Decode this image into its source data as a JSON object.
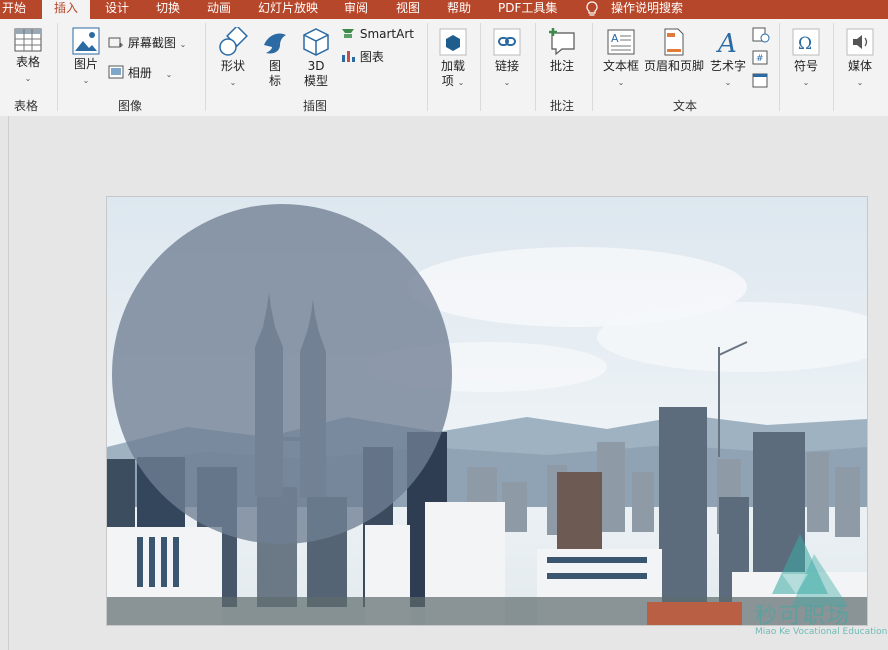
{
  "tabs": [
    {
      "label": "开始",
      "active": false
    },
    {
      "label": "插入",
      "active": true
    },
    {
      "label": "设计",
      "active": false
    },
    {
      "label": "切换",
      "active": false
    },
    {
      "label": "动画",
      "active": false
    },
    {
      "label": "幻灯片放映",
      "active": false
    },
    {
      "label": "审阅",
      "active": false
    },
    {
      "label": "视图",
      "active": false
    },
    {
      "label": "帮助",
      "active": false
    },
    {
      "label": "PDF工具集",
      "active": false
    }
  ],
  "tell_me": "操作说明搜索",
  "groups": {
    "table": {
      "label": "表格",
      "buttons": {
        "table": "表格"
      }
    },
    "images": {
      "label": "图像",
      "buttons": {
        "picture": "图片",
        "screenshot": "屏幕截图",
        "album": "相册"
      }
    },
    "illustrations": {
      "label": "插图",
      "buttons": {
        "shapes": "形状",
        "icons_1": "图",
        "icons_2": "标",
        "model_1": "3D",
        "model_2": "模型",
        "smartart": "SmartArt",
        "chart": "图表"
      }
    },
    "addins": {
      "buttons": {
        "addins_1": "加载",
        "addins_2": "项"
      }
    },
    "links": {
      "buttons": {
        "link": "链接"
      }
    },
    "comments": {
      "label": "批注",
      "buttons": {
        "comment": "批注"
      }
    },
    "text": {
      "label": "文本",
      "buttons": {
        "textbox": "文本框",
        "header_footer": "页眉和页脚",
        "wordart": "艺术字"
      }
    },
    "symbols": {
      "buttons": {
        "symbol": "符号"
      }
    },
    "media": {
      "buttons": {
        "media": "媒体"
      }
    }
  },
  "watermark": {
    "name": "秒可职场",
    "sub": "Miao Ke Vocational Education"
  },
  "colors": {
    "accent": "#b7472a",
    "ribbon_bg": "#f3f3f3",
    "circle_fill": "#6f7f94"
  }
}
